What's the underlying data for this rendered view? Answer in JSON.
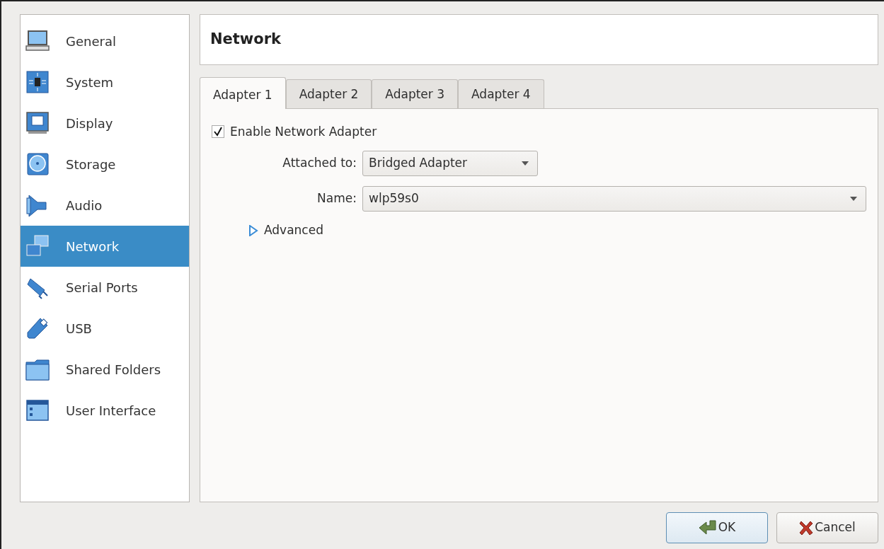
{
  "sidebar": {
    "items": [
      {
        "label": "General",
        "selected": false
      },
      {
        "label": "System",
        "selected": false
      },
      {
        "label": "Display",
        "selected": false
      },
      {
        "label": "Storage",
        "selected": false
      },
      {
        "label": "Audio",
        "selected": false
      },
      {
        "label": "Network",
        "selected": true
      },
      {
        "label": "Serial Ports",
        "selected": false
      },
      {
        "label": "USB",
        "selected": false
      },
      {
        "label": "Shared Folders",
        "selected": false
      },
      {
        "label": "User Interface",
        "selected": false
      }
    ]
  },
  "page_title": "Network",
  "tabs": [
    {
      "label": "Adapter 1",
      "selected": true
    },
    {
      "label": "Adapter 2",
      "selected": false
    },
    {
      "label": "Adapter 3",
      "selected": false
    },
    {
      "label": "Adapter 4",
      "selected": false
    }
  ],
  "enable_adapter": {
    "label": "Enable Network Adapter",
    "checked": true
  },
  "attached_to": {
    "label": "Attached to:",
    "value": "Bridged Adapter"
  },
  "name": {
    "label": "Name:",
    "value": "wlp59s0"
  },
  "advanced": {
    "label": "Advanced",
    "expanded": false
  },
  "buttons": [
    {
      "label": "OK",
      "kind": "ok"
    },
    {
      "label": "Cancel",
      "kind": "cancel"
    }
  ]
}
